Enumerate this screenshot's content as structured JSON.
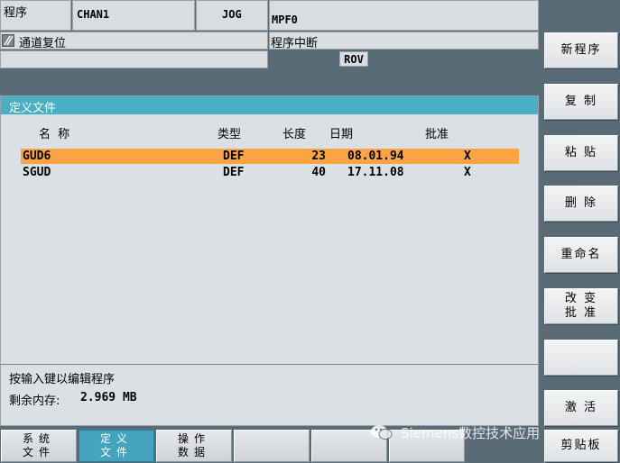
{
  "header": {
    "area_label": "程序",
    "channel": "CHAN1",
    "mode": "JOG",
    "program": "MPF0",
    "channel_status_icon": "channel-reset-icon",
    "channel_status": "通道复位",
    "program_status": "程序中断",
    "rov_badge": "ROV"
  },
  "panel": {
    "title": "定义文件",
    "columns": [
      "名 称",
      "类型",
      "长度",
      "日期",
      "批准"
    ],
    "rows": [
      {
        "name": "GUD6",
        "type": "DEF",
        "length": "23",
        "date": "08.01.94",
        "approval": "X"
      },
      {
        "name": "SGUD",
        "type": "DEF",
        "length": "40",
        "date": "17.11.08",
        "approval": "X"
      }
    ],
    "hint": "按输入键以编辑程序",
    "memory_label": "剩余内存:",
    "memory_value": "2.969 MB"
  },
  "softkeys_right": [
    {
      "label": "新程序"
    },
    {
      "label": "复 制"
    },
    {
      "label": "粘 贴"
    },
    {
      "label": "删 除"
    },
    {
      "label": "重命名"
    },
    {
      "label": "改 变\n批 准"
    },
    {
      "label": ""
    },
    {
      "label": "激 活"
    },
    {
      "label": "剪贴板"
    }
  ],
  "softkeys_bottom": [
    {
      "label": "系统\n文件",
      "active": false
    },
    {
      "label": "定义\n文件",
      "active": true
    },
    {
      "label": "操作\n数据",
      "active": false
    },
    {
      "label": "",
      "active": false
    },
    {
      "label": "",
      "active": false
    },
    {
      "label": "",
      "active": false
    }
  ],
  "watermark": "Siemens数控技术应用",
  "colors": {
    "background": "#5a6b78",
    "title_bar": "#4aaec4",
    "selected_row": "#fba441",
    "active_softkey": "#44a3bf"
  }
}
